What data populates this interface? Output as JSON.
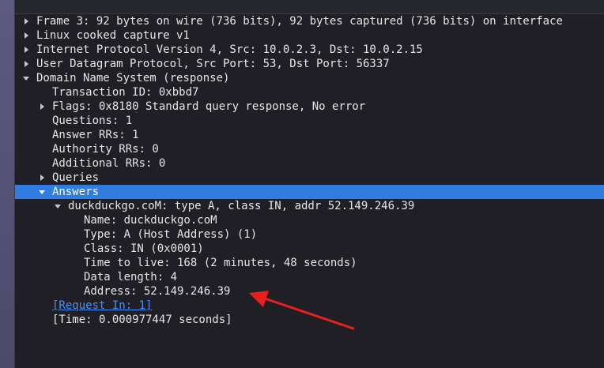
{
  "packet_tree": {
    "frame": "Frame 3: 92 bytes on wire (736 bits), 92 bytes captured (736 bits) on interface",
    "linux_cooked": "Linux cooked capture v1",
    "ip": "Internet Protocol Version 4, Src: 10.0.2.3, Dst: 10.0.2.15",
    "udp": "User Datagram Protocol, Src Port: 53, Dst Port: 56337",
    "dns": "Domain Name System (response)",
    "transaction_id": "Transaction ID: 0xbbd7",
    "flags": "Flags: 0x8180 Standard query response, No error",
    "questions": "Questions: 1",
    "answer_rrs": "Answer RRs: 1",
    "authority_rrs": "Authority RRs: 0",
    "additional_rrs": "Additional RRs: 0",
    "queries": "Queries",
    "answers": "Answers",
    "answer_record": "duckduckgo.coM: type A, class IN, addr 52.149.246.39",
    "name": "Name: duckduckgo.coM",
    "type": "Type: A (Host Address) (1)",
    "class": "Class: IN (0x0001)",
    "ttl": "Time to live: 168 (2 minutes, 48 seconds)",
    "data_length": "Data length: 4",
    "address": "Address: 52.149.246.39",
    "request_in": "[Request In: 1]",
    "time": "[Time: 0.000977447 seconds]"
  },
  "icons": {
    "collapsed": "triangle-right-icon",
    "expanded": "triangle-down-icon"
  },
  "colors": {
    "background": "#1f1f25",
    "text": "#e6e6e6",
    "selection": "#2f7de0",
    "link": "#4c8ff0",
    "annotation_arrow": "#e8201c"
  }
}
